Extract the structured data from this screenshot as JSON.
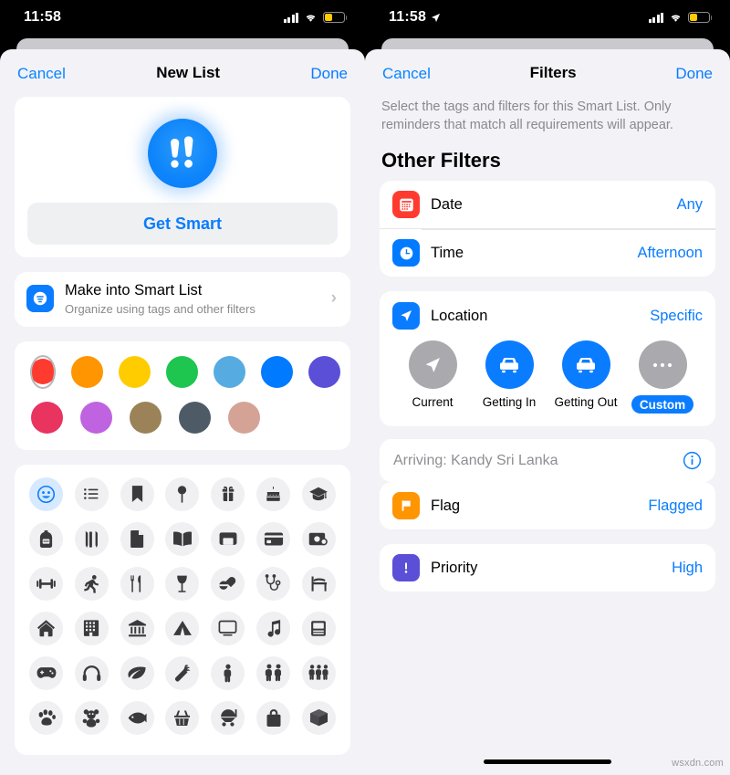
{
  "left": {
    "status": {
      "time": "11:58",
      "battery_color": "#ffcc00"
    },
    "nav": {
      "cancel": "Cancel",
      "title": "New List",
      "done": "Done"
    },
    "hero": {
      "glyph": "double-exclamation-icon",
      "button": "Get Smart"
    },
    "smart_row": {
      "icon": "smart-list-icon",
      "title": "Make into Smart List",
      "subtitle": "Organize using tags and other filters",
      "chevron": "chevron-right-icon"
    },
    "colors": {
      "rows": [
        [
          {
            "name": "red",
            "hex": "#ff3b30",
            "selected": false
          },
          {
            "name": "orange",
            "hex": "#ff9500",
            "selected": false
          },
          {
            "name": "yellow",
            "hex": "#ffcc00",
            "selected": false
          },
          {
            "name": "green",
            "hex": "#1ec54f",
            "selected": false
          },
          {
            "name": "light-blue",
            "hex": "#56ace0",
            "selected": false
          },
          {
            "name": "blue",
            "hex": "#007aff",
            "selected": true
          },
          {
            "name": "indigo",
            "hex": "#5a4fd6",
            "selected": false
          }
        ],
        [
          {
            "name": "pink",
            "hex": "#e8345f",
            "selected": false
          },
          {
            "name": "purple",
            "hex": "#bf63e0",
            "selected": false
          },
          {
            "name": "brown",
            "hex": "#9c8259",
            "selected": false
          },
          {
            "name": "slate",
            "hex": "#4e5b66",
            "selected": false
          },
          {
            "name": "taupe",
            "hex": "#d5a396",
            "selected": false
          }
        ]
      ]
    },
    "icons": {
      "rows": [
        [
          "smiley-icon",
          "list-icon",
          "bookmark-icon",
          "pin-icon",
          "gift-icon",
          "cake-icon",
          "graduation-cap-icon"
        ],
        [
          "backpack-icon",
          "pencils-icon",
          "document-icon",
          "book-icon",
          "wallet-icon",
          "credit-card-icon",
          "money-icon"
        ],
        [
          "dumbbell-icon",
          "running-icon",
          "fork-knife-icon",
          "wine-glass-icon",
          "pills-icon",
          "stethoscope-icon",
          "chair-icon"
        ],
        [
          "house-icon",
          "building-icon",
          "bank-icon",
          "tent-icon",
          "tv-icon",
          "music-note-icon",
          "laptop-icon"
        ],
        [
          "game-controller-icon",
          "headphones-icon",
          "leaf-icon",
          "carrot-icon",
          "person-icon",
          "two-people-icon",
          "three-people-icon"
        ],
        [
          "paw-icon",
          "teddy-bear-icon",
          "fish-icon",
          "basket-icon",
          "stroller-icon",
          "shopping-bag-icon",
          "box-icon"
        ]
      ],
      "selected": "smiley-icon"
    }
  },
  "right": {
    "status": {
      "time": "11:58",
      "location_arrow": "location-arrow-icon",
      "battery_color": "#ffcc00"
    },
    "nav": {
      "cancel": "Cancel",
      "title": "Filters",
      "done": "Done"
    },
    "description": "Select the tags and filters for this Smart List. Only reminders that match all requirements will appear.",
    "section_title": "Other Filters",
    "rows_group_1": [
      {
        "icon": "calendar-icon",
        "icon_color": "#ff3b30",
        "label": "Date",
        "value": "Any"
      },
      {
        "icon": "clock-icon",
        "icon_color": "#007aff",
        "label": "Time",
        "value": "Afternoon"
      }
    ],
    "location": {
      "icon": "location-arrow-icon",
      "icon_color": "#0a7cff",
      "label": "Location",
      "value": "Specific",
      "options": [
        {
          "icon": "location-arrow-icon",
          "label": "Current",
          "bubble": "grey",
          "selected": false
        },
        {
          "icon": "car-icon",
          "label": "Getting In",
          "bubble": "blue",
          "selected": false
        },
        {
          "icon": "car-icon",
          "label": "Getting Out",
          "bubble": "blue",
          "selected": false
        },
        {
          "icon": "ellipsis-icon",
          "label": "Custom",
          "bubble": "grey",
          "selected": true
        }
      ],
      "address": "Arriving: Kandy Sri Lanka",
      "info_icon": "info-circle-icon"
    },
    "rows_group_2": [
      {
        "icon": "flag-icon",
        "icon_color": "#ff9500",
        "label": "Flag",
        "value": "Flagged"
      }
    ],
    "rows_group_3": [
      {
        "icon": "exclamation-icon",
        "icon_color": "#5a4fd6",
        "label": "Priority",
        "value": "High"
      }
    ]
  },
  "watermark": "wsxdn.com"
}
